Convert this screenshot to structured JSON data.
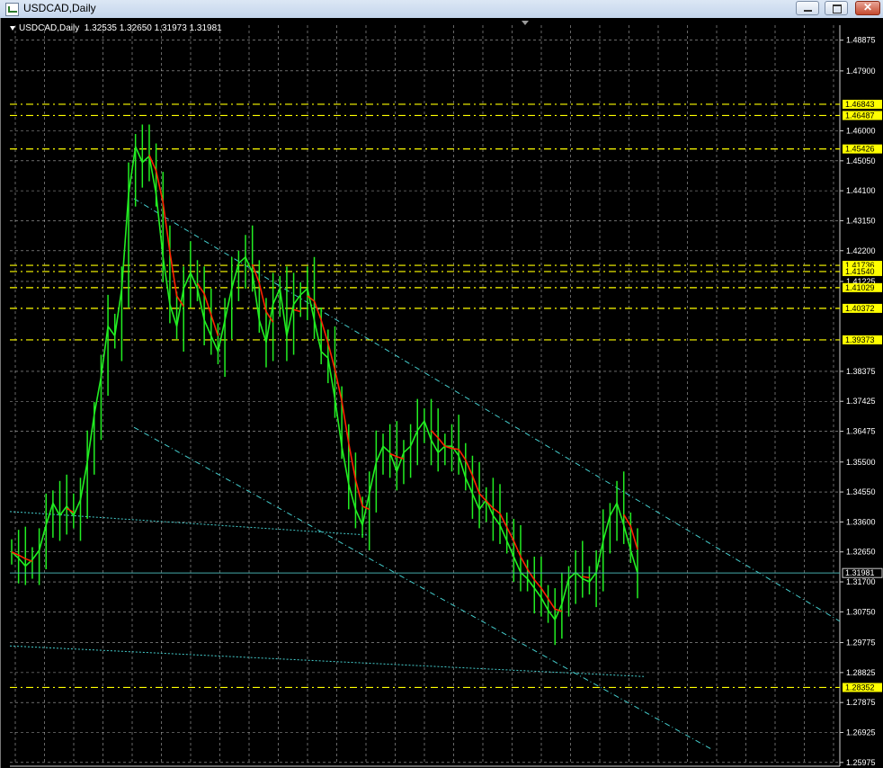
{
  "window": {
    "title": "USDCAD,Daily",
    "minimize_symbol": "",
    "maximize_symbol": "",
    "close_symbol": "✕"
  },
  "chart": {
    "header": "USDCAD,Daily  1.32535 1.32650 1.31973 1.31981",
    "colors": {
      "grid": "#c8c8c8",
      "price_bars": "#22ee22",
      "moving_average": "#ff2200",
      "trendlines": "#44cccc",
      "levels": "#ffff00",
      "current_price_line": "#44aaaa"
    },
    "current_price_label": "1.31981"
  },
  "chart_data": {
    "type": "line",
    "symbol": "USDCAD",
    "timeframe": "Daily",
    "ohlc_last": {
      "open": 1.32535,
      "high": 1.3265,
      "low": 1.31973,
      "close": 1.31981
    },
    "ylim": [
      1.2597,
      1.4935
    ],
    "y_ticks": [
      "1.48875",
      "1.47900",
      "1.46000",
      "1.45050",
      "1.44100",
      "1.43150",
      "1.42200",
      "1.41225",
      "1.38375",
      "1.37425",
      "1.36475",
      "1.35500",
      "1.34550",
      "1.33600",
      "1.32650",
      "1.31700",
      "1.30750",
      "1.29775",
      "1.28825",
      "1.27875",
      "1.26925",
      "1.25975"
    ],
    "levels": [
      "1.46843",
      "1.46487",
      "1.45426",
      "1.41736",
      "1.41540",
      "1.41029",
      "1.40372",
      "1.39373",
      "1.28352"
    ],
    "close_series": [
      1.3265,
      1.3245,
      1.322,
      1.324,
      1.327,
      1.335,
      1.342,
      1.338,
      1.341,
      1.338,
      1.343,
      1.355,
      1.37,
      1.382,
      1.398,
      1.395,
      1.41,
      1.44,
      1.455,
      1.45,
      1.452,
      1.44,
      1.42,
      1.405,
      1.398,
      1.41,
      1.415,
      1.41,
      1.4,
      1.395,
      1.39,
      1.4,
      1.41,
      1.418,
      1.42,
      1.415,
      1.4,
      1.393,
      1.405,
      1.41,
      1.395,
      1.405,
      1.408,
      1.41,
      1.4,
      1.39,
      1.388,
      1.375,
      1.36,
      1.348,
      1.34,
      1.335,
      1.345,
      1.355,
      1.36,
      1.358,
      1.352,
      1.358,
      1.36,
      1.365,
      1.368,
      1.362,
      1.358,
      1.36,
      1.36,
      1.357,
      1.35,
      1.345,
      1.34,
      1.343,
      1.338,
      1.335,
      1.33,
      1.325,
      1.32,
      1.318,
      1.315,
      1.312,
      1.308,
      1.305,
      1.31,
      1.318,
      1.32,
      1.318,
      1.317,
      1.32,
      1.33,
      1.338,
      1.342,
      1.335,
      1.327,
      1.3198
    ]
  }
}
